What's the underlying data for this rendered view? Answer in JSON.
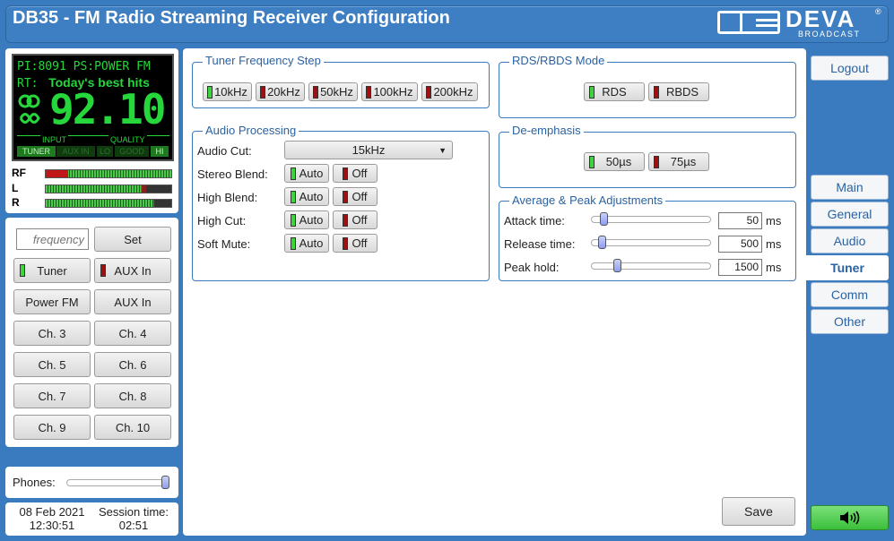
{
  "header": {
    "title": "DB35 - FM Radio Streaming Receiver Configuration",
    "logo_text": "DEVA",
    "logo_sub": "BROADCAST",
    "logo_reg": "®"
  },
  "display": {
    "pi_label": "PI:",
    "pi_value": "8091",
    "ps_label": "PS:",
    "ps_value": "POWER FM",
    "rt_label": "RT:",
    "rt_value": "Today's best hits",
    "frequency": "92.10",
    "input_label": "INPUT",
    "quality_label": "QUALITY",
    "inputs": [
      "TUNER",
      "AUX IN"
    ],
    "quality": [
      "LO",
      "GOOD",
      "HI"
    ]
  },
  "meters": {
    "rf": "RF",
    "l": "L",
    "r": "R"
  },
  "left_controls": {
    "frequency_placeholder": "frequency",
    "set": "Set",
    "tuner": "Tuner",
    "aux_in": "AUX In",
    "presets": [
      "Power FM",
      "AUX In",
      "Ch. 3",
      "Ch. 4",
      "Ch. 5",
      "Ch. 6",
      "Ch. 7",
      "Ch. 8",
      "Ch. 9",
      "Ch. 10"
    ]
  },
  "phones": {
    "label": "Phones:"
  },
  "status": {
    "date": "08 Feb 2021",
    "time": "12:30:51",
    "session_label": "Session time:",
    "session_value": "02:51"
  },
  "tuner_step": {
    "legend": "Tuner Frequency Step",
    "options": [
      "10kHz",
      "20kHz",
      "50kHz",
      "100kHz",
      "200kHz"
    ]
  },
  "audio": {
    "legend": "Audio Processing",
    "audio_cut_label": "Audio Cut:",
    "audio_cut_value": "15kHz",
    "rows": [
      {
        "label": "Stereo Blend:",
        "a": "Auto",
        "b": "Off"
      },
      {
        "label": "High Blend:",
        "a": "Auto",
        "b": "Off"
      },
      {
        "label": "High Cut:",
        "a": "Auto",
        "b": "Off"
      },
      {
        "label": "Soft Mute:",
        "a": "Auto",
        "b": "Off"
      }
    ]
  },
  "rds": {
    "legend": "RDS/RBDS Mode",
    "options": [
      "RDS",
      "RBDS"
    ]
  },
  "deemph": {
    "legend": "De-emphasis",
    "options": [
      "50µs",
      "75µs"
    ]
  },
  "avgpeak": {
    "legend": "Average & Peak Adjustments",
    "rows": [
      {
        "label": "Attack time:",
        "value": "50",
        "unit": "ms"
      },
      {
        "label": "Release time:",
        "value": "500",
        "unit": "ms"
      },
      {
        "label": "Peak hold:",
        "value": "1500",
        "unit": "ms"
      }
    ]
  },
  "save": "Save",
  "nav": {
    "logout": "Logout",
    "tabs": [
      "Main",
      "General",
      "Audio",
      "Tuner",
      "Comm",
      "Other"
    ]
  },
  "colors": {
    "accent": "#3a7bbf",
    "display_green": "#25d73a",
    "led_on": "#39d539",
    "led_off": "#a01010"
  }
}
